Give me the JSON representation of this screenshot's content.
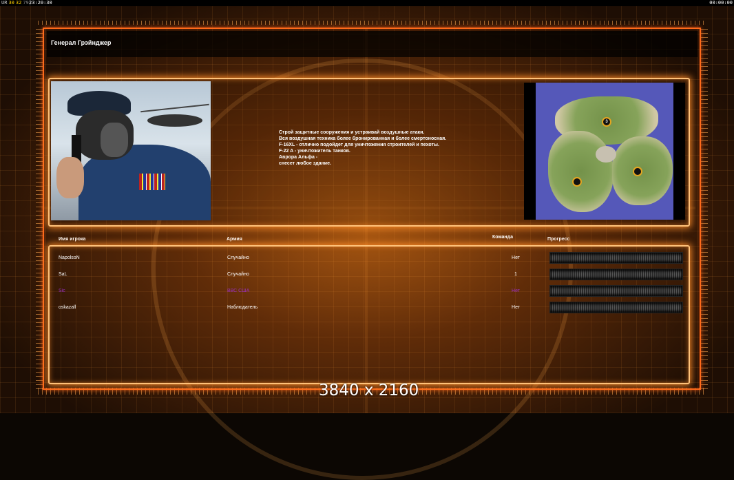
{
  "overlay": {
    "fps": [
      "UR",
      "30",
      "32",
      "79|"
    ],
    "clock": "23:20:30",
    "timer": "00:00:00"
  },
  "screen": {
    "title": "Генерал Грэйнджер"
  },
  "briefing": {
    "lines": [
      "Строй защитные сооружения и устраивай воздушные атаки.",
      "Вся воздушная техника более бронированная и более смертоносная.",
      "F-16XL - отлично подойдет для уничтожения строителей и пехоты.",
      "F-22 A - уничтожитель танков.",
      "Аврора Альфа -",
      "снесет любое здание."
    ]
  },
  "map": {
    "start_positions": [
      "3",
      "",
      ""
    ]
  },
  "players": {
    "headers": {
      "name": "Имя игрока",
      "army": "Армия",
      "team": "Команда",
      "progress": "Прогресс"
    },
    "rows": [
      {
        "name": "NapolsoN",
        "army": "Случайно",
        "team": "Нет",
        "progress": 0,
        "color": "#ffffff"
      },
      {
        "name": "SaL",
        "army": "Случайно",
        "team": "1",
        "progress": 0,
        "color": "#ffffff"
      },
      {
        "name": "Sic",
        "army": "ВВС США",
        "team": "Нет",
        "progress": 0,
        "color": "#9a2fc4"
      },
      {
        "name": "oskazall",
        "army": "Наблюдатель",
        "team": "Нет",
        "progress": 0,
        "color": "#ffffff"
      }
    ]
  },
  "watermark": {
    "resolution": "3840 x 2160"
  }
}
